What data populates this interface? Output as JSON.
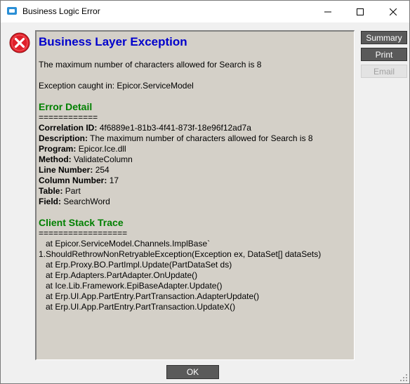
{
  "window": {
    "title": "Business Logic Error",
    "minimize_glyph": "—",
    "maximize_glyph": "☐",
    "close_glyph": "✕"
  },
  "icons": {
    "app": "app-icon",
    "error": "error-icon",
    "error_color": "#e0202a"
  },
  "message": {
    "heading": "Business Layer Exception",
    "text": "The maximum number of characters allowed for Search is 8",
    "caught_in": "Exception caught in: Epicor.ServiceModel"
  },
  "error_detail": {
    "heading": "Error Detail",
    "separator": "============",
    "fields": [
      {
        "label": "Correlation ID:",
        "value": "4f6889e1-81b3-4f41-873f-18e96f12ad7a"
      },
      {
        "label": "Description:",
        "value": "The maximum number of characters allowed for Search is 8"
      },
      {
        "label": "Program:",
        "value": "Epicor.Ice.dll"
      },
      {
        "label": "Method:",
        "value": "ValidateColumn"
      },
      {
        "label": "Line Number:",
        "value": "254"
      },
      {
        "label": "Column Number:",
        "value": "17"
      },
      {
        "label": "Table:",
        "value": "Part"
      },
      {
        "label": "Field:",
        "value": "SearchWord"
      }
    ]
  },
  "stack_trace": {
    "heading": "Client Stack Trace",
    "separator": "==================",
    "lines": [
      "   at Epicor.ServiceModel.Channels.ImplBase`",
      "1.ShouldRethrowNonRetryableException(Exception ex, DataSet[] dataSets)",
      "   at Erp.Proxy.BO.PartImpl.Update(PartDataSet ds)",
      "   at Erp.Adapters.PartAdapter.OnUpdate()",
      "   at Ice.Lib.Framework.EpiBaseAdapter.Update()",
      "   at Erp.UI.App.PartEntry.PartTransaction.AdapterUpdate()",
      "   at Erp.UI.App.PartEntry.PartTransaction.UpdateX()"
    ]
  },
  "buttons": {
    "summary": "Summary",
    "print": "Print",
    "email": "Email",
    "ok": "OK"
  }
}
